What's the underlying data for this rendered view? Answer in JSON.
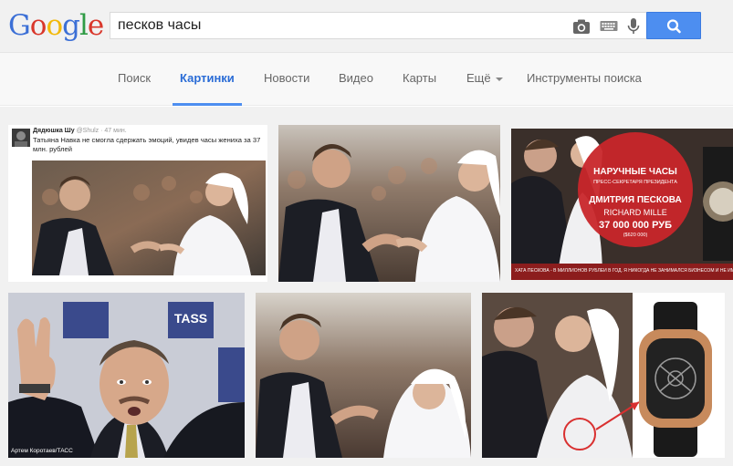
{
  "header": {
    "logo_letters": [
      "G",
      "o",
      "o",
      "g",
      "l",
      "e"
    ],
    "logo_colors": [
      "#3b6fd6",
      "#d9372b",
      "#f2b90a",
      "#3b6fd6",
      "#2f9b45",
      "#d9372b"
    ],
    "search": {
      "value": "песков часы"
    },
    "icons": [
      "camera-icon",
      "keyboard-icon",
      "microphone-icon",
      "search-icon"
    ]
  },
  "nav": {
    "items": [
      "Поиск",
      "Картинки",
      "Новости",
      "Видео",
      "Карты",
      "Ещё",
      "Инструменты поиска"
    ],
    "active_index": 1
  },
  "results": {
    "tweet": {
      "name": "Дядюшка Шу",
      "handle": "@Shulz · 47 мин.",
      "text": "Татьяна Навка не смогла сдержать эмоций, увидев часы жениха за 37 млн. рублей"
    },
    "watch_ad": {
      "title": "НАРУЧНЫЕ ЧАСЫ",
      "subtitle": "ПРЕСС-СЕКРЕТАРЯ ПРЕЗИДЕНТА",
      "owner": "ДМИТРИЯ ПЕСКОВА",
      "brand": "RICHARD MILLE",
      "price": "37 000 000 РУБ",
      "usd": "($620 000)",
      "ticker": "ХАТА ПЕСКОВА - В МИЛЛИОНОВ РУБЛЕЙ В ГОД. Я НИКОГДА НЕ ЗАНИМАЛСЯ БИЗНЕСОМ И НЕ ИМЕЕТ ДРУГИХ"
    },
    "tass": {
      "caption": "Артем Коротаев/ТАСС",
      "backdrop": "TASS"
    }
  },
  "colors": {
    "accent": "#4d8ef0",
    "active_tab": "#2a6cd6",
    "ad_red": "#c8262a"
  }
}
